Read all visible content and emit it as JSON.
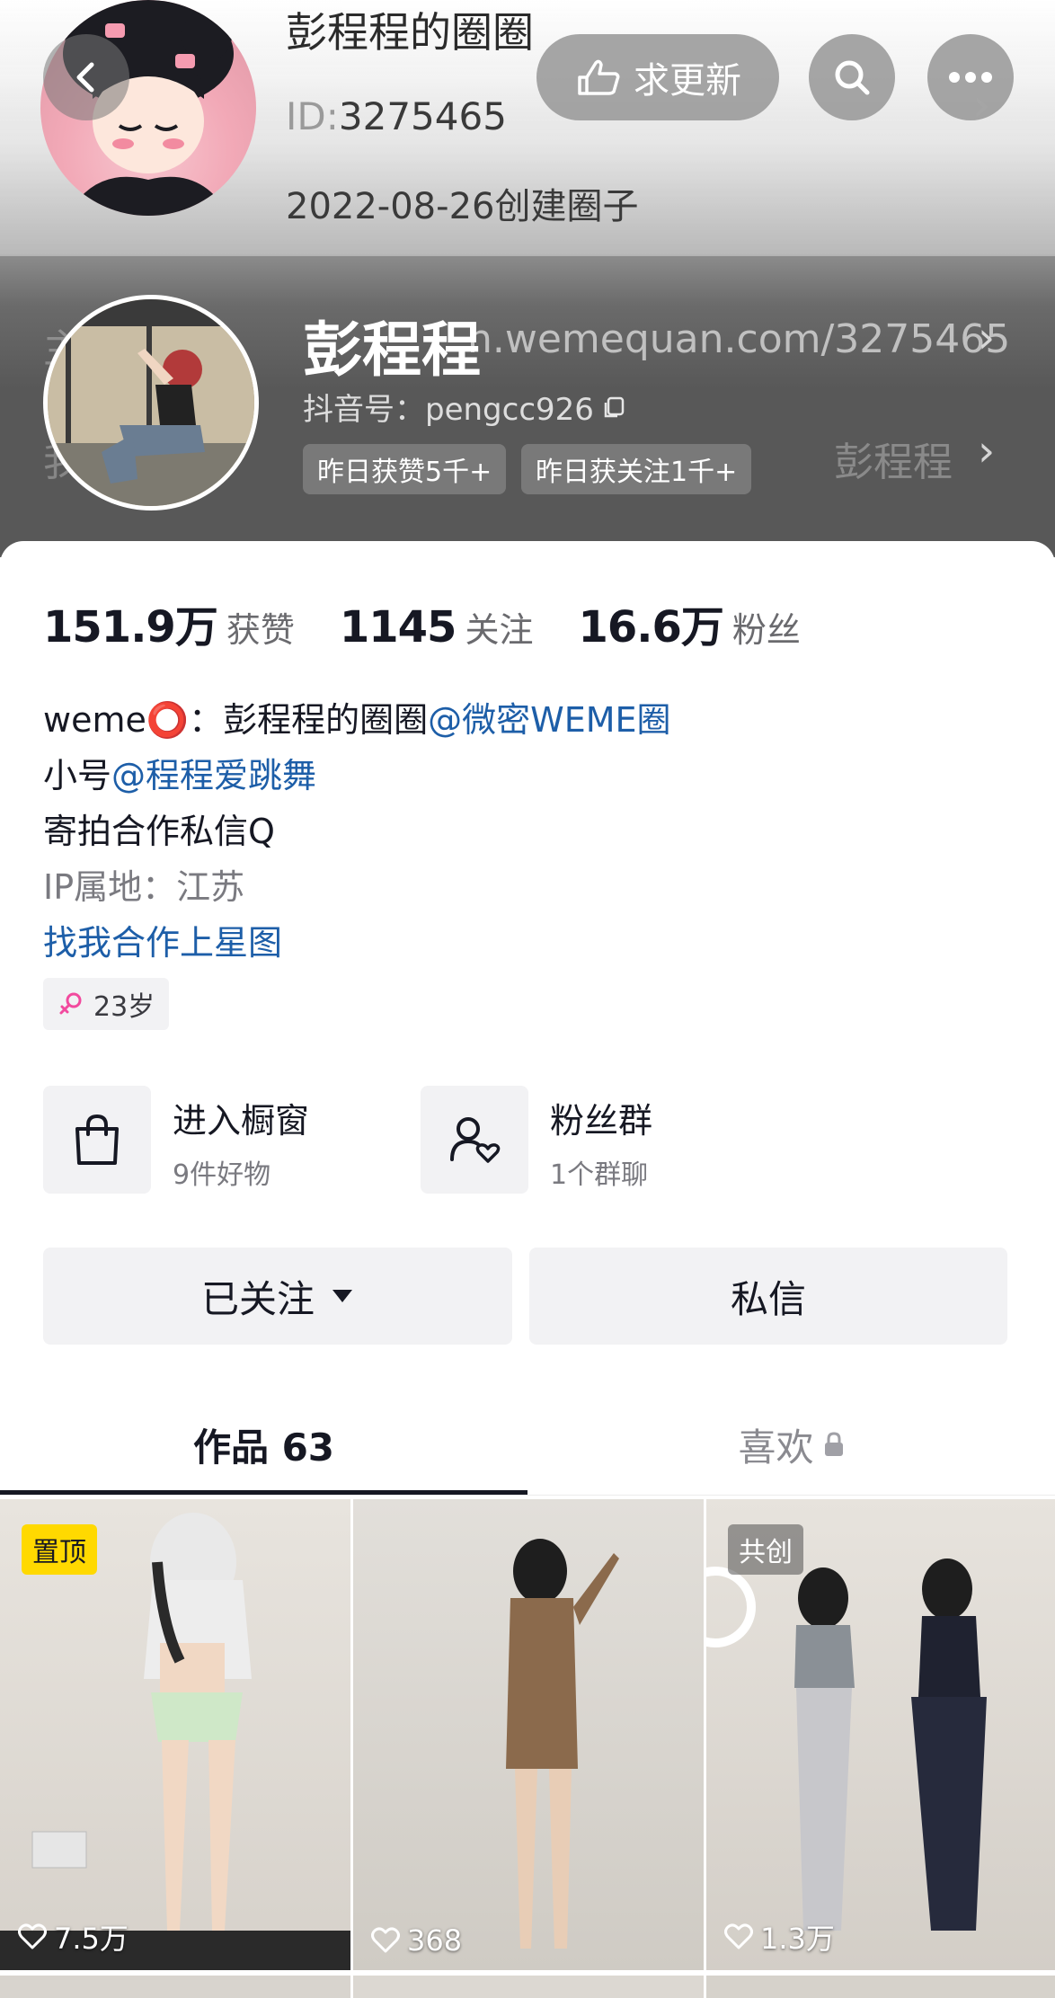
{
  "circle": {
    "title": "彭程程的圈圈",
    "id_label": "ID:",
    "id_value": "3275465",
    "created": "2022-08-26创建圈子"
  },
  "topbar": {
    "request_label": "求更新"
  },
  "ghost": {
    "url": "n.wemequan.com/3275465",
    "right_text": "彭程程"
  },
  "profile": {
    "name": "彭程程",
    "douyin_id": "抖音号：pengcc926",
    "pills": [
      "昨日获赞5千+",
      "昨日获关注1千+"
    ]
  },
  "stats": [
    {
      "value": "151.9万",
      "label": "获赞"
    },
    {
      "value": "1145",
      "label": "关注"
    },
    {
      "value": "16.6万",
      "label": "粉丝"
    }
  ],
  "bio": {
    "line1_prefix": "weme⭕：彭程程的圈圈",
    "line1_link": "@微密WEME圈",
    "line2_prefix": "小号",
    "line2_link": "@程程爱跳舞",
    "line3": "寄拍合作私信Q",
    "line4": "IP属地：江苏",
    "line5": "找我合作上星图",
    "age": "23岁"
  },
  "entries": [
    {
      "title": "进入橱窗",
      "sub": "9件好物"
    },
    {
      "title": "粉丝群",
      "sub": "1个群聊"
    }
  ],
  "actions": {
    "followed": "已关注",
    "message": "私信"
  },
  "tabs": {
    "works": "作品 63",
    "likes": "喜欢"
  },
  "videos": [
    {
      "badge": "置顶",
      "likes": "7.5万"
    },
    {
      "badge": "",
      "likes": "368"
    },
    {
      "badge": "共创",
      "likes": "1.3万"
    }
  ],
  "colors": {
    "link": "#1d5ea8",
    "pin_badge": "#ffd900",
    "age_icon": "#f24a9e"
  }
}
